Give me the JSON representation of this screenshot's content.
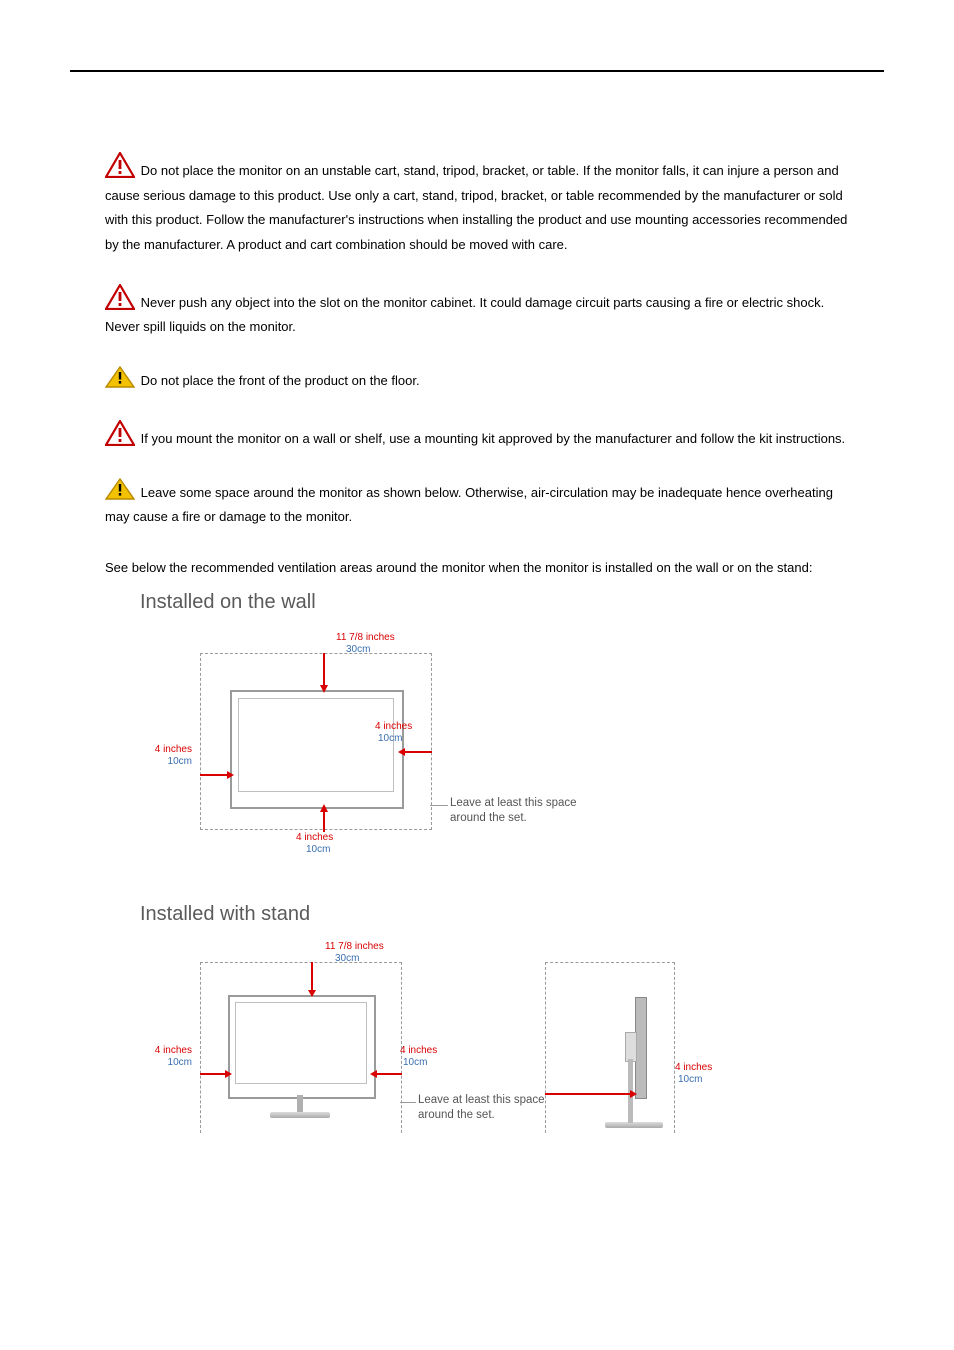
{
  "warnings": {
    "w1": "Do not place the monitor on an unstable cart, stand, tripod, bracket, or table. If the monitor falls, it can injure a person and cause serious damage to this product. Use only a cart, stand, tripod, bracket, or table recommended by the manufacturer or sold with this product. Follow the manufacturer's instructions when installing the product and use mounting accessories recommended by the manufacturer. A product and cart combination should be moved with care.",
    "w2": "Never push any object into the slot on the monitor cabinet. It could damage circuit parts causing a fire or electric shock. Never spill liquids on the monitor.",
    "w3": "Do not place the front of the product on the floor.",
    "w4": "If you mount the monitor on a wall or shelf, use a mounting kit approved by the manufacturer and follow the kit instructions.",
    "w5": "Leave some space around the monitor as shown below. Otherwise, air-circulation may be inadequate hence overheating may cause a fire or damage to the monitor."
  },
  "intro": "See below the recommended ventilation areas around the monitor when the monitor is installed on the wall or on the stand:",
  "diagrams": {
    "wall": {
      "title": "Installed on the wall",
      "top_in": "11 7/8 inches",
      "top_cm": "30cm",
      "left_in": "4 inches",
      "left_cm": "10cm",
      "right_in": "4 inches",
      "right_cm": "10cm",
      "bottom_in": "4 inches",
      "bottom_cm": "10cm",
      "note_l1": "Leave at least this space",
      "note_l2": "around the set."
    },
    "stand": {
      "title": "Installed with stand",
      "top_in": "11 7/8 inches",
      "top_cm": "30cm",
      "left_in": "4 inches",
      "left_cm": "10cm",
      "right_in": "4 inches",
      "right_cm": "10cm",
      "side_in": "4 inches",
      "side_cm": "10cm",
      "note_l1": "Leave at least this space",
      "note_l2": "around the set."
    }
  }
}
